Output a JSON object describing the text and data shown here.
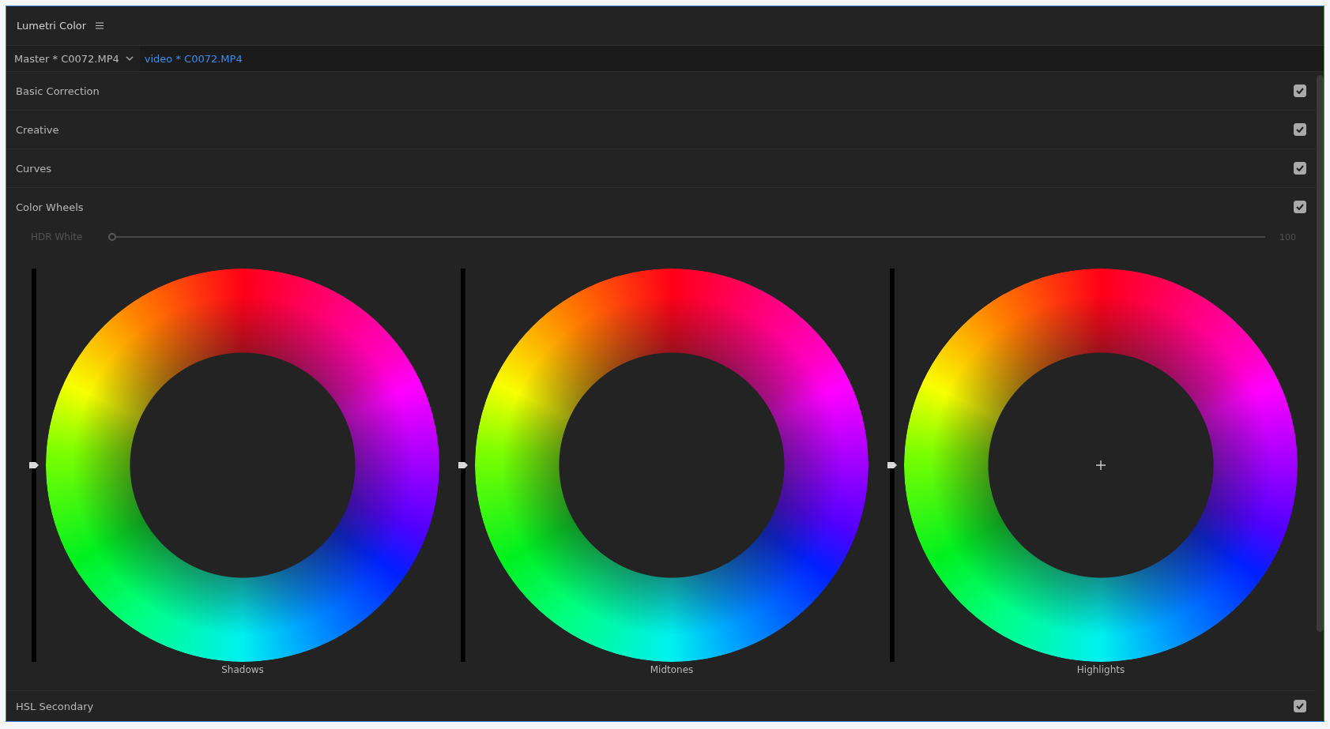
{
  "panel": {
    "title": "Lumetri Color"
  },
  "tabs": [
    {
      "label": "Master * C0072.MP4",
      "selected": false,
      "dropdown": true
    },
    {
      "label": "video * C0072.MP4",
      "selected": true,
      "dropdown": false
    }
  ],
  "sections": [
    {
      "label": "Basic Correction",
      "checked": true
    },
    {
      "label": "Creative",
      "checked": true
    },
    {
      "label": "Curves",
      "checked": true
    },
    {
      "label": "Color Wheels",
      "checked": true
    }
  ],
  "hdr_slider": {
    "label": "HDR White",
    "level": 0,
    "reading": "100",
    "disabled": true
  },
  "wheels": [
    {
      "label": "Shadows",
      "level": 0.5,
      "crosshair": false
    },
    {
      "label": "Midtones",
      "level": 0.5,
      "crosshair": false
    },
    {
      "label": "Highlights",
      "level": 0.5,
      "crosshair": true
    }
  ],
  "last_section": {
    "label": "HSL Secondary",
    "checked": true
  }
}
